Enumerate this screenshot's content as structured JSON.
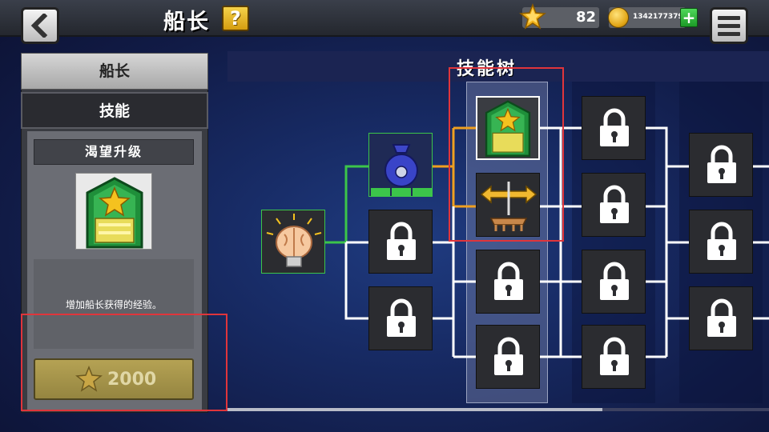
{
  "header": {
    "title": "船长",
    "help_label": "?",
    "stars": "82",
    "coins": "1342177379",
    "add_label": "+"
  },
  "left_tabs": [
    {
      "label": "船长"
    },
    {
      "label": "技能"
    }
  ],
  "skill_detail": {
    "name": "渴望升级",
    "description": "增加船长获得的经验。",
    "cost": "2000",
    "icon": "green-rank-badge-icon"
  },
  "tree": {
    "title": "技能树",
    "nodes": [
      {
        "icon": "brain-lightbulb-icon",
        "state": "unlocked"
      },
      {
        "icon": "money-bag-icon",
        "state": "unlocked"
      },
      {
        "icon": "lock-icon",
        "state": "locked"
      },
      {
        "icon": "lock-icon",
        "state": "locked"
      },
      {
        "icon": "green-rank-badge-icon",
        "state": "selected"
      },
      {
        "icon": "arrows-dock-icon",
        "state": "available"
      },
      {
        "icon": "lock-icon",
        "state": "locked"
      },
      {
        "icon": "lock-icon",
        "state": "locked"
      },
      {
        "icon": "lock-icon",
        "state": "locked"
      },
      {
        "icon": "lock-icon",
        "state": "locked"
      },
      {
        "icon": "lock-icon",
        "state": "locked"
      },
      {
        "icon": "lock-icon",
        "state": "locked"
      },
      {
        "icon": "lock-icon",
        "state": "locked"
      },
      {
        "icon": "lock-icon",
        "state": "locked"
      },
      {
        "icon": "lock-icon",
        "state": "locked"
      }
    ]
  },
  "colors": {
    "highlight_box": "#e0353b",
    "path_active": "#f0a020",
    "path_unlocked": "#3cc54a",
    "path_locked": "#ffffff"
  }
}
